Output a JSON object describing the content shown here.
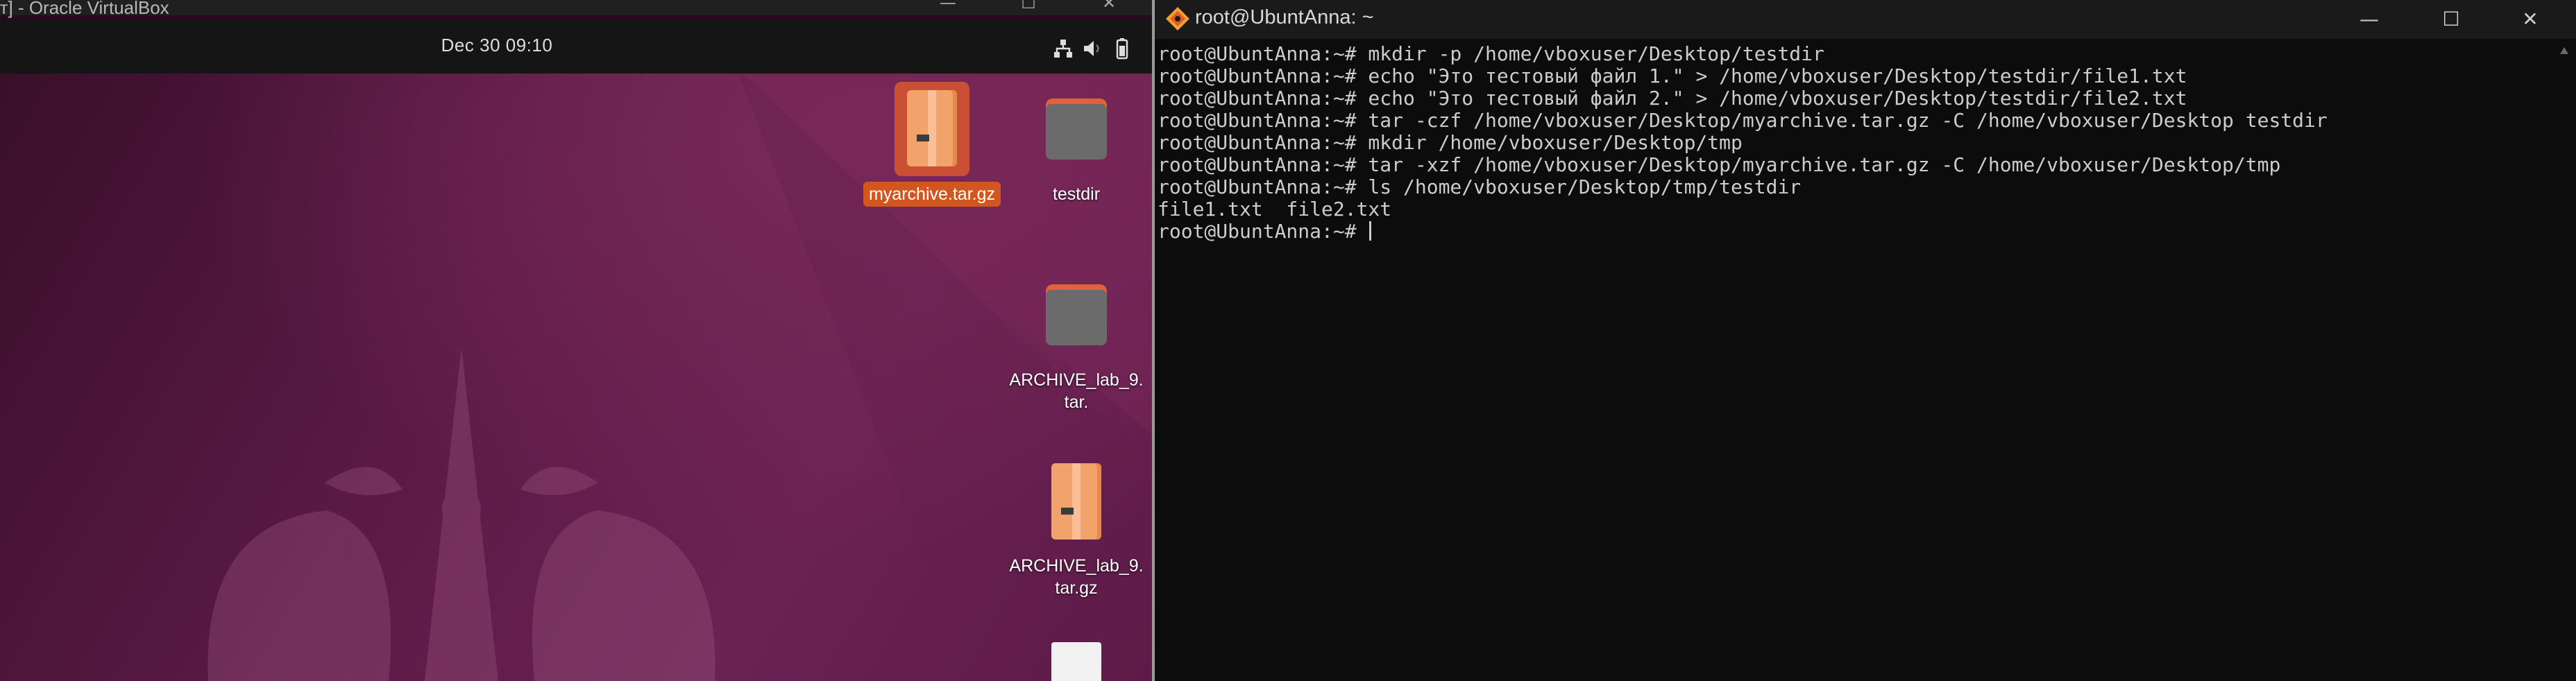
{
  "vbox": {
    "title": "ет] - Oracle VirtualBox",
    "topbar": {
      "clock": "Dec 30  09:10"
    },
    "desktop_items": [
      {
        "label": "myarchive.tar.gz",
        "icon": "archive-icon",
        "selected": true
      },
      {
        "label": "testdir",
        "icon": "folder-icon"
      },
      {
        "label": "ARCHIVE_lab_9.\ntar.",
        "icon": "folder-icon"
      },
      {
        "label": "ARCHIVE_lab_9.\ntar.gz",
        "icon": "archive-icon"
      },
      {
        "label": "",
        "icon": "document-icon"
      }
    ]
  },
  "terminal": {
    "title": "root@UbuntAnna: ~",
    "lines": [
      "root@UbuntAnna:~# mkdir -p /home/vboxuser/Desktop/testdir",
      "root@UbuntAnna:~# echo \"Это тестовый файл 1.\" > /home/vboxuser/Desktop/testdir/file1.txt",
      "root@UbuntAnna:~# echo \"Это тестовый файл 2.\" > /home/vboxuser/Desktop/testdir/file2.txt",
      "root@UbuntAnna:~# tar -czf /home/vboxuser/Desktop/myarchive.tar.gz -C /home/vboxuser/Desktop testdir",
      "root@UbuntAnna:~# mkdir /home/vboxuser/Desktop/tmp",
      "root@UbuntAnna:~# tar -xzf /home/vboxuser/Desktop/myarchive.tar.gz -C /home/vboxuser/Desktop/tmp",
      "root@UbuntAnna:~# ls /home/vboxuser/Desktop/tmp/testdir",
      "file1.txt  file2.txt"
    ],
    "prompt": "root@UbuntAnna:~# "
  },
  "colors": {
    "selection": "#d4561f",
    "folder_tab": "#e0623a",
    "archive": "#f2a36b",
    "terminal_bg": "#0c0c0c",
    "terminal_fg": "#cccccc"
  }
}
